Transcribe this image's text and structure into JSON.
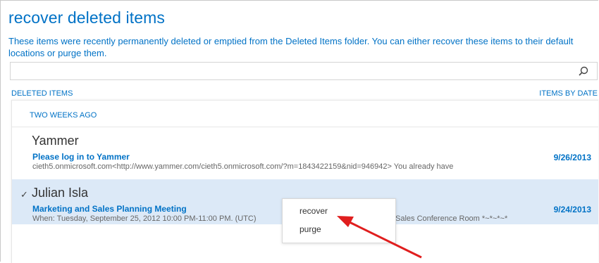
{
  "page": {
    "title": "recover deleted items",
    "description": "These items were recently permanently deleted or emptied from the Deleted Items folder. You can either recover these items to their default locations or purge them."
  },
  "search": {
    "value": "",
    "placeholder": ""
  },
  "list": {
    "left_header": "DELETED ITEMS",
    "right_header": "ITEMS BY DATE",
    "group": "TWO WEEKS AGO",
    "items": [
      {
        "name": "Yammer",
        "subject": "Please log in to Yammer",
        "preview": "cieth5.onmicrosoft.com<http://www.yammer.com/cieth5.onmicrosoft.com/?m=1843422159&nid=946942> You already have",
        "date": "9/26/2013",
        "check": ""
      },
      {
        "name": "Julian Isla",
        "subject": "Marketing and Sales Planning Meeting",
        "preview": "When: Tuesday, September 25, 2012 10:00 PM-11:00 PM. (UTC)",
        "preview_tail": "Sales Conference Room *~*~*~*",
        "date": "9/24/2013",
        "check": "✓"
      }
    ]
  },
  "context_menu": {
    "recover": "recover",
    "purge": "purge"
  },
  "colors": {
    "accent": "#0072c6",
    "selected_row": "#dce9f7",
    "arrow": "#e01e1e"
  }
}
